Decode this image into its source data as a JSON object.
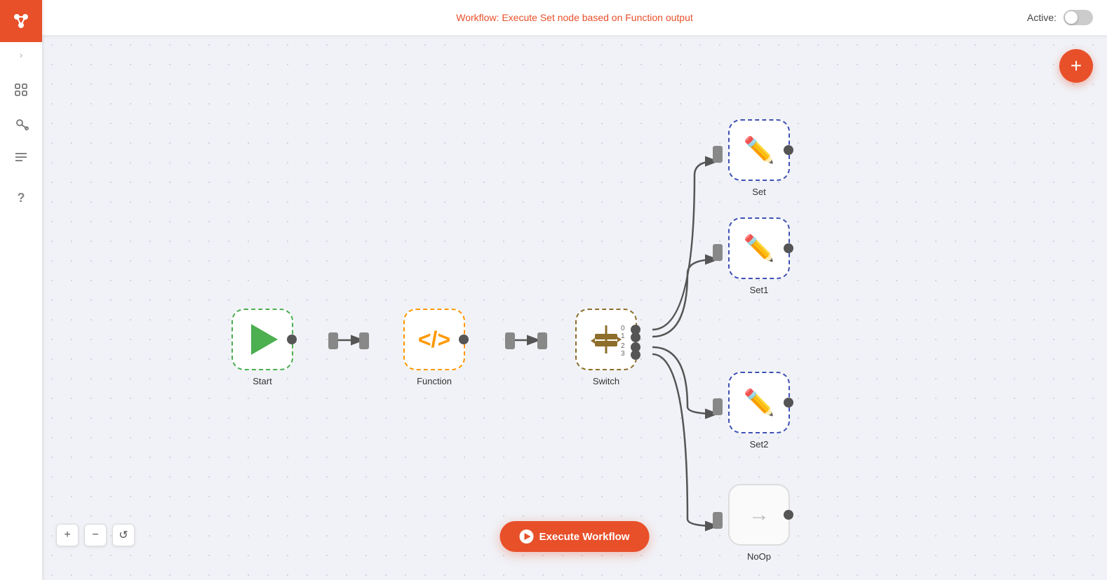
{
  "header": {
    "workflow_label": "Workflow:",
    "workflow_name": "Execute Set node based on Function output",
    "active_label": "Active:"
  },
  "sidebar": {
    "logo_icon": "n8n-logo",
    "collapse_icon": "chevron-right",
    "items": [
      {
        "id": "integrations",
        "icon": "⊞",
        "label": "Integrations"
      },
      {
        "id": "credentials",
        "icon": "🔑",
        "label": "Credentials"
      },
      {
        "id": "executions",
        "icon": "≡",
        "label": "Executions"
      },
      {
        "id": "help",
        "icon": "?",
        "label": "Help"
      }
    ]
  },
  "nodes": {
    "start": {
      "label": "Start"
    },
    "function": {
      "label": "Function"
    },
    "switch": {
      "label": "Switch"
    },
    "set": {
      "label": "Set"
    },
    "set1": {
      "label": "Set1"
    },
    "set2": {
      "label": "Set2"
    },
    "noop": {
      "label": "NoOp"
    }
  },
  "buttons": {
    "execute": "Execute Workflow",
    "zoom_in": "+",
    "zoom_out": "−",
    "reset": "↺",
    "add": "+"
  },
  "connections": {
    "switch_outputs": [
      "0",
      "1",
      "2",
      "3"
    ]
  }
}
